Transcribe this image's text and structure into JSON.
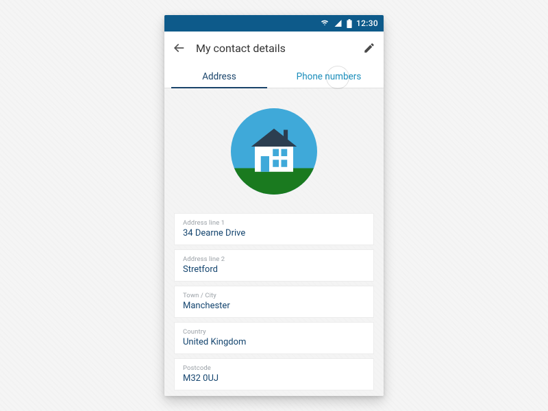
{
  "status": {
    "time": "12:30"
  },
  "header": {
    "title": "My contact details"
  },
  "tabs": {
    "address": {
      "label": "Address",
      "active": true
    },
    "phone": {
      "label": "Phone numbers",
      "active": false
    }
  },
  "fields": [
    {
      "label": "Address line 1",
      "value": "34 Dearne Drive"
    },
    {
      "label": "Address line 2",
      "value": "Stretford"
    },
    {
      "label": "Town / City",
      "value": "Manchester"
    },
    {
      "label": "Country",
      "value": "United Kingdom"
    },
    {
      "label": "Postcode",
      "value": "M32 0UJ"
    }
  ],
  "icons": {
    "back": "back-arrow",
    "edit": "pencil",
    "wifi": "wifi",
    "signal": "signal",
    "battery": "battery"
  },
  "colors": {
    "primary": "#0d5a8a",
    "accent": "#1a8dbb",
    "fieldText": "#13446e"
  }
}
